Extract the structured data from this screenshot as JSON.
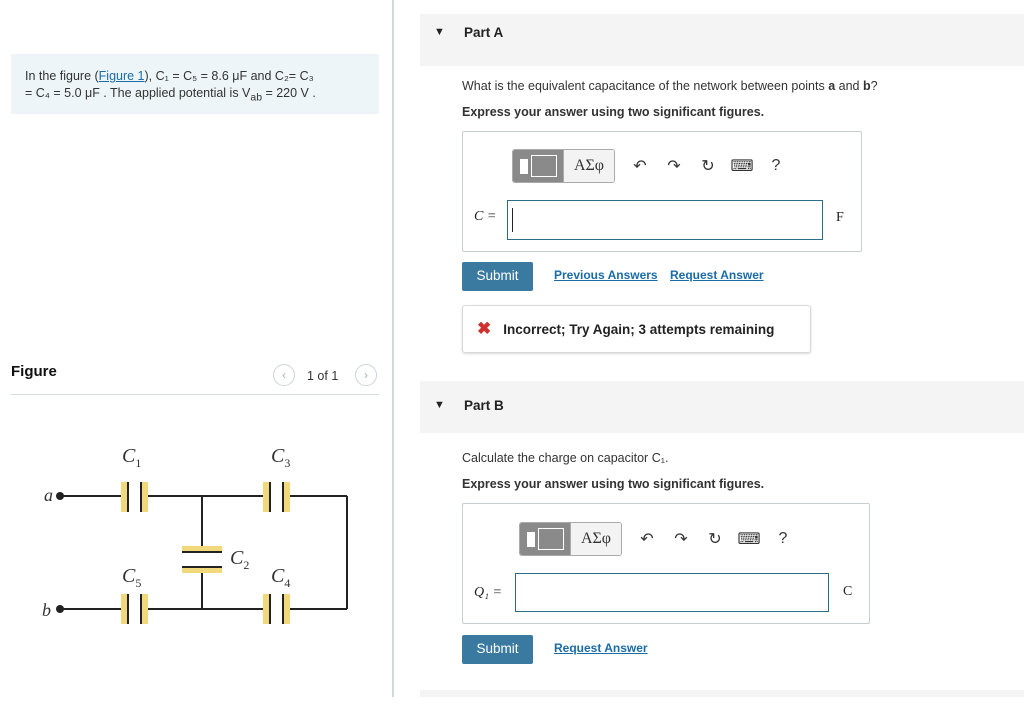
{
  "problem": {
    "prefix": "In the figure (",
    "figure_link": "Figure 1",
    "suffix": "), ",
    "line1_math": "C₁ = C₅ = 8.6 μF and C₂= C₃",
    "line2_math": "= C₄ = 5.0 μF . The applied potential is V",
    "vab_sub": "ab",
    "line2_end": " = 220 V ."
  },
  "figure": {
    "label": "Figure",
    "pager": "1 of 1",
    "prev_icon": "‹",
    "next_icon": "›",
    "labels": {
      "c1": "C",
      "c1s": "1",
      "c3": "C",
      "c3s": "3",
      "c2": "C",
      "c2s": "2",
      "c5": "C",
      "c5s": "5",
      "c4": "C",
      "c4s": "4",
      "a": "a",
      "b": "b"
    },
    "cap_color": "#f1d87a"
  },
  "partA": {
    "caret": "▼",
    "title": "Part A",
    "question_pre": "What is the equivalent capacitance of the network between points ",
    "a": "a",
    "and": " and ",
    "b": "b",
    "question_end": "?",
    "instruction": "Express your answer using two significant figures.",
    "toolbar": {
      "greek": "ΑΣφ",
      "undo": "↶",
      "redo": "↷",
      "reset": "↻",
      "keyboard": "⌨",
      "help": "?"
    },
    "var_label": "C =",
    "unit": "F",
    "input_value": "",
    "submit": "Submit",
    "prev_answers": "Previous Answers",
    "request_answer": "Request Answer",
    "feedback": "Incorrect; Try Again; 3 attempts remaining",
    "feedback_icon": "✖"
  },
  "partB": {
    "caret": "▼",
    "title": "Part B",
    "question": "Calculate the charge on capacitor C₁.",
    "instruction": "Express your answer using two significant figures.",
    "toolbar": {
      "greek": "ΑΣφ",
      "undo": "↶",
      "redo": "↷",
      "reset": "↻",
      "keyboard": "⌨",
      "help": "?"
    },
    "var_label": "Q₁ =",
    "unit": "C",
    "input_value": "",
    "submit": "Submit",
    "request_answer": "Request Answer"
  }
}
